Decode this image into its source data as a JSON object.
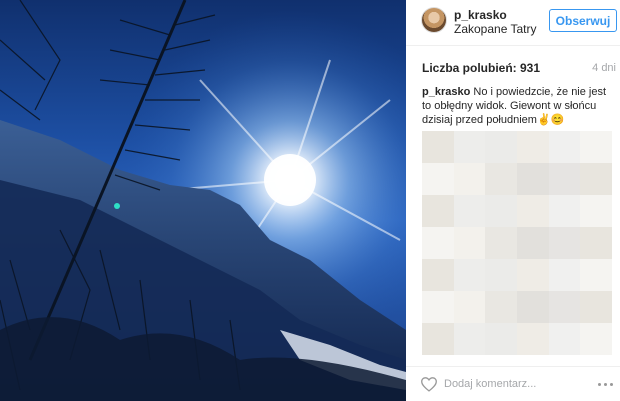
{
  "post": {
    "username": "p_krasko",
    "location": "Zakopane Tatry",
    "follow_label": "Obserwuj",
    "likes_label": "Liczba polubień: 931",
    "time": "4 dni",
    "caption_user": "p_krasko",
    "caption_text": " No i powiedzcie, że nie jest to obłędny widok. Giewont w słońcu dzisiaj przed południem✌😊"
  },
  "comment_box": {
    "placeholder": "Dodaj komentarz..."
  },
  "icons": {
    "like": "heart-icon",
    "more": "more-options-icon"
  },
  "colors": {
    "accent": "#3897f0",
    "text": "#262626",
    "muted": "#a5a7aa"
  }
}
